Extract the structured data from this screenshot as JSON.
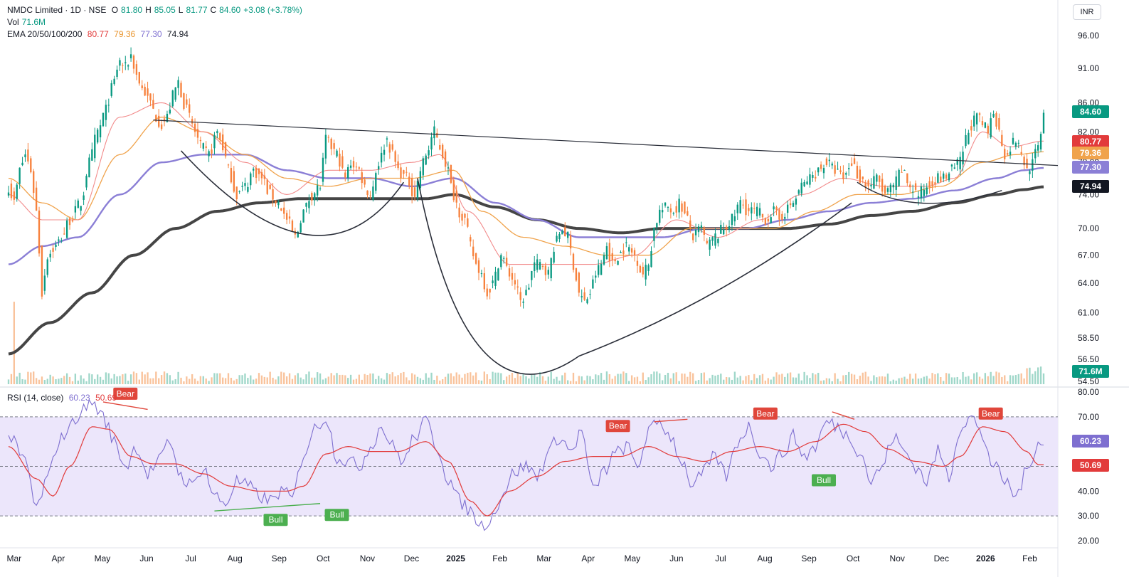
{
  "header": {
    "symbol": "NMDC Limited · 1D · NSE",
    "open_label": "O",
    "open": "81.80",
    "high_label": "H",
    "high": "85.05",
    "low_label": "L",
    "low": "81.77",
    "close_label": "C",
    "close": "84.60",
    "change": "+3.08 (+3.78%)",
    "vol_label": "Vol",
    "vol_value": "71.6M",
    "ema_label": "EMA 20/50/100/200",
    "ema20": "80.77",
    "ema50": "79.36",
    "ema100": "77.30",
    "ema200": "74.94",
    "currency": "INR"
  },
  "rsi_header": {
    "label": "RSI (14, close)",
    "rsi": "60.23",
    "ma": "50.69"
  },
  "colors": {
    "up": "#089981",
    "down": "#f7813c",
    "ema20": "#f28b8b",
    "ema50": "#f0a34c",
    "ema100": "#8b7fd6",
    "ema200": "#454545",
    "rsi": "#7e6fd0",
    "rsi_ma": "#e23b3b",
    "rsi_band": "#ece6fb",
    "bull": "#4caf50",
    "bear": "#e0463b"
  },
  "chart_data": {
    "type": "candlestick",
    "price_axis": {
      "ticks": [
        "96.00",
        "91.00",
        "86.00",
        "82.00",
        "78.00",
        "74.00",
        "70.00",
        "67.00",
        "64.00",
        "61.00",
        "58.50",
        "56.50",
        "54.50"
      ],
      "ylim": [
        54.5,
        96.0
      ],
      "scale": "log"
    },
    "time_axis": {
      "ticks": [
        "Mar",
        "Apr",
        "May",
        "Jun",
        "Jul",
        "Aug",
        "Sep",
        "Oct",
        "Nov",
        "Dec",
        "2025",
        "Feb",
        "Mar",
        "Apr",
        "May",
        "Jun",
        "Jul",
        "Aug",
        "Sep",
        "Oct",
        "Nov",
        "Dec",
        "2026",
        "Feb"
      ],
      "bold_ticks": [
        "2025",
        "2026"
      ]
    },
    "rsi_axis": {
      "ticks": [
        "80.00",
        "70.00",
        "60.00",
        "50.00",
        "40.00",
        "30.00",
        "20.00"
      ],
      "ylim": [
        20,
        80
      ],
      "band": [
        30,
        70
      ]
    },
    "price_anchors": [
      [
        0,
        75
      ],
      [
        2,
        73
      ],
      [
        4,
        77
      ],
      [
        6,
        79
      ],
      [
        8,
        77
      ],
      [
        10,
        72
      ],
      [
        12,
        63
      ],
      [
        14,
        67
      ],
      [
        17,
        68
      ],
      [
        19,
        69
      ],
      [
        22,
        71
      ],
      [
        26,
        73
      ],
      [
        29,
        78
      ],
      [
        32,
        82
      ],
      [
        35,
        85
      ],
      [
        37,
        88
      ],
      [
        40,
        92
      ],
      [
        42,
        91
      ],
      [
        44,
        93
      ],
      [
        46,
        90
      ],
      [
        48,
        88
      ],
      [
        51,
        86
      ],
      [
        53,
        84
      ],
      [
        55,
        83
      ],
      [
        57,
        84
      ],
      [
        59,
        87
      ],
      [
        61,
        89
      ],
      [
        63,
        86
      ],
      [
        65,
        84
      ],
      [
        67,
        82
      ],
      [
        69,
        80
      ],
      [
        72,
        79
      ],
      [
        75,
        82
      ],
      [
        77,
        80
      ],
      [
        79,
        77
      ],
      [
        82,
        74
      ],
      [
        85,
        75
      ],
      [
        88,
        77
      ],
      [
        91,
        76
      ],
      [
        94,
        74
      ],
      [
        97,
        73
      ],
      [
        100,
        71
      ],
      [
        103,
        69
      ],
      [
        106,
        72
      ],
      [
        109,
        74
      ],
      [
        112,
        75
      ],
      [
        114,
        81
      ],
      [
        116,
        80
      ],
      [
        118,
        79
      ],
      [
        121,
        76
      ],
      [
        123,
        78
      ],
      [
        126,
        77
      ],
      [
        128,
        75
      ],
      [
        130,
        74
      ],
      [
        133,
        78
      ],
      [
        136,
        81
      ],
      [
        138,
        79
      ],
      [
        140,
        77
      ],
      [
        143,
        76
      ],
      [
        146,
        74
      ],
      [
        148,
        77
      ],
      [
        150,
        79
      ],
      [
        153,
        82
      ],
      [
        155,
        80
      ],
      [
        157,
        78
      ],
      [
        160,
        74
      ],
      [
        162,
        72
      ],
      [
        164,
        71
      ],
      [
        166,
        68
      ],
      [
        168,
        66
      ],
      [
        170,
        65
      ],
      [
        172,
        63
      ],
      [
        174,
        64
      ],
      [
        177,
        67
      ],
      [
        180,
        65
      ],
      [
        182,
        64
      ],
      [
        184,
        62
      ],
      [
        186,
        63
      ],
      [
        189,
        66
      ],
      [
        192,
        66
      ],
      [
        194,
        65
      ],
      [
        196,
        68
      ],
      [
        199,
        70
      ],
      [
        201,
        69
      ],
      [
        203,
        66
      ],
      [
        205,
        63
      ],
      [
        207,
        62
      ],
      [
        209,
        63
      ],
      [
        211,
        65
      ],
      [
        213,
        66
      ],
      [
        215,
        68
      ],
      [
        217,
        66
      ],
      [
        219,
        67
      ],
      [
        222,
        68
      ],
      [
        225,
        67
      ],
      [
        228,
        65
      ],
      [
        230,
        66
      ],
      [
        232,
        70
      ],
      [
        234,
        72
      ],
      [
        237,
        72.5
      ],
      [
        239,
        72
      ],
      [
        241,
        73
      ],
      [
        244,
        71
      ],
      [
        246,
        69
      ],
      [
        249,
        70
      ],
      [
        251,
        68
      ],
      [
        254,
        69
      ],
      [
        257,
        70
      ],
      [
        260,
        71
      ],
      [
        263,
        73
      ],
      [
        266,
        72
      ],
      [
        269,
        72
      ],
      [
        272,
        71
      ],
      [
        275,
        72
      ],
      [
        277,
        71
      ],
      [
        279,
        72
      ],
      [
        282,
        73
      ],
      [
        285,
        75
      ],
      [
        288,
        76
      ],
      [
        291,
        77
      ],
      [
        294,
        78
      ],
      [
        297,
        77
      ],
      [
        300,
        76
      ],
      [
        303,
        78
      ],
      [
        306,
        76
      ],
      [
        309,
        75
      ],
      [
        312,
        76
      ],
      [
        315,
        74
      ],
      [
        318,
        75
      ],
      [
        321,
        77
      ],
      [
        324,
        75
      ],
      [
        327,
        74
      ],
      [
        330,
        75
      ],
      [
        333,
        76
      ],
      [
        336,
        76
      ],
      [
        339,
        77
      ],
      [
        342,
        78
      ],
      [
        344,
        81
      ],
      [
        346,
        83
      ],
      [
        348,
        84
      ],
      [
        350,
        83
      ],
      [
        352,
        82
      ],
      [
        354,
        85
      ],
      [
        356,
        82
      ],
      [
        358,
        79
      ],
      [
        360,
        80
      ],
      [
        362,
        81
      ],
      [
        364,
        79
      ],
      [
        366,
        77
      ],
      [
        368,
        78
      ],
      [
        370,
        80
      ],
      [
        372,
        84.6
      ]
    ],
    "ema20_anchors": [
      [
        0,
        74
      ],
      [
        12,
        71
      ],
      [
        25,
        71
      ],
      [
        40,
        84
      ],
      [
        55,
        86
      ],
      [
        70,
        82
      ],
      [
        85,
        78
      ],
      [
        100,
        74
      ],
      [
        115,
        77
      ],
      [
        130,
        77
      ],
      [
        145,
        78
      ],
      [
        155,
        79
      ],
      [
        165,
        72
      ],
      [
        180,
        66
      ],
      [
        195,
        66
      ],
      [
        210,
        66
      ],
      [
        225,
        67
      ],
      [
        240,
        71
      ],
      [
        255,
        69
      ],
      [
        270,
        71
      ],
      [
        285,
        74
      ],
      [
        300,
        76
      ],
      [
        315,
        75
      ],
      [
        330,
        75
      ],
      [
        340,
        76
      ],
      [
        350,
        82
      ],
      [
        360,
        80
      ],
      [
        372,
        80.77
      ]
    ],
    "ema50_anchors": [
      [
        0,
        76
      ],
      [
        12,
        73
      ],
      [
        25,
        71
      ],
      [
        40,
        79
      ],
      [
        55,
        84
      ],
      [
        70,
        82
      ],
      [
        85,
        79
      ],
      [
        100,
        76
      ],
      [
        115,
        75
      ],
      [
        130,
        76
      ],
      [
        145,
        76
      ],
      [
        160,
        77
      ],
      [
        170,
        72
      ],
      [
        185,
        69
      ],
      [
        200,
        68
      ],
      [
        215,
        67
      ],
      [
        230,
        67
      ],
      [
        245,
        70
      ],
      [
        260,
        70
      ],
      [
        275,
        70
      ],
      [
        290,
        72
      ],
      [
        305,
        74
      ],
      [
        320,
        74
      ],
      [
        335,
        75
      ],
      [
        350,
        78
      ],
      [
        362,
        79
      ],
      [
        372,
        79.36
      ]
    ],
    "ema100_anchors": [
      [
        0,
        66
      ],
      [
        12,
        68
      ],
      [
        25,
        69
      ],
      [
        40,
        74
      ],
      [
        55,
        78
      ],
      [
        70,
        79
      ],
      [
        85,
        79
      ],
      [
        100,
        77
      ],
      [
        115,
        76
      ],
      [
        130,
        76
      ],
      [
        145,
        75
      ],
      [
        160,
        76
      ],
      [
        175,
        73
      ],
      [
        190,
        71
      ],
      [
        205,
        69
      ],
      [
        220,
        69
      ],
      [
        235,
        69
      ],
      [
        250,
        70
      ],
      [
        265,
        70
      ],
      [
        280,
        71
      ],
      [
        295,
        72
      ],
      [
        310,
        73
      ],
      [
        325,
        73.5
      ],
      [
        340,
        74.5
      ],
      [
        355,
        76
      ],
      [
        365,
        77
      ],
      [
        372,
        77.3
      ]
    ],
    "ema200_anchors": [
      [
        0,
        57
      ],
      [
        15,
        60
      ],
      [
        30,
        63
      ],
      [
        45,
        67
      ],
      [
        60,
        70
      ],
      [
        75,
        72
      ],
      [
        90,
        73
      ],
      [
        105,
        73.5
      ],
      [
        120,
        73.5
      ],
      [
        135,
        73.5
      ],
      [
        150,
        73.5
      ],
      [
        160,
        74
      ],
      [
        175,
        72.5
      ],
      [
        190,
        71
      ],
      [
        205,
        70
      ],
      [
        220,
        69.5
      ],
      [
        235,
        70
      ],
      [
        250,
        70
      ],
      [
        265,
        70
      ],
      [
        280,
        70
      ],
      [
        295,
        70.5
      ],
      [
        310,
        71.5
      ],
      [
        325,
        72
      ],
      [
        340,
        73
      ],
      [
        355,
        74
      ],
      [
        365,
        74.6
      ],
      [
        372,
        74.94
      ]
    ],
    "rsi_anchors": [
      [
        0,
        62
      ],
      [
        6,
        52
      ],
      [
        10,
        33
      ],
      [
        14,
        45
      ],
      [
        18,
        60
      ],
      [
        22,
        66
      ],
      [
        26,
        72
      ],
      [
        30,
        76
      ],
      [
        34,
        70
      ],
      [
        38,
        60
      ],
      [
        42,
        50
      ],
      [
        46,
        58
      ],
      [
        50,
        47
      ],
      [
        54,
        52
      ],
      [
        58,
        60
      ],
      [
        62,
        46
      ],
      [
        66,
        42
      ],
      [
        70,
        50
      ],
      [
        74,
        38
      ],
      [
        78,
        35
      ],
      [
        82,
        44
      ],
      [
        86,
        42
      ],
      [
        90,
        38
      ],
      [
        94,
        36
      ],
      [
        98,
        40
      ],
      [
        102,
        37
      ],
      [
        106,
        55
      ],
      [
        110,
        65
      ],
      [
        114,
        70
      ],
      [
        118,
        54
      ],
      [
        122,
        52
      ],
      [
        126,
        50
      ],
      [
        130,
        58
      ],
      [
        134,
        66
      ],
      [
        138,
        58
      ],
      [
        142,
        52
      ],
      [
        146,
        62
      ],
      [
        150,
        68
      ],
      [
        154,
        58
      ],
      [
        158,
        45
      ],
      [
        162,
        36
      ],
      [
        166,
        32
      ],
      [
        170,
        26
      ],
      [
        174,
        30
      ],
      [
        178,
        40
      ],
      [
        182,
        48
      ],
      [
        186,
        50
      ],
      [
        190,
        46
      ],
      [
        194,
        56
      ],
      [
        198,
        62
      ],
      [
        202,
        56
      ],
      [
        206,
        64
      ],
      [
        210,
        40
      ],
      [
        214,
        48
      ],
      [
        218,
        55
      ],
      [
        222,
        58
      ],
      [
        226,
        50
      ],
      [
        230,
        64
      ],
      [
        234,
        68
      ],
      [
        238,
        62
      ],
      [
        242,
        52
      ],
      [
        246,
        42
      ],
      [
        250,
        48
      ],
      [
        254,
        54
      ],
      [
        258,
        46
      ],
      [
        262,
        60
      ],
      [
        266,
        66
      ],
      [
        270,
        56
      ],
      [
        274,
        50
      ],
      [
        278,
        55
      ],
      [
        282,
        62
      ],
      [
        286,
        54
      ],
      [
        290,
        58
      ],
      [
        294,
        68
      ],
      [
        298,
        66
      ],
      [
        302,
        62
      ],
      [
        306,
        56
      ],
      [
        310,
        44
      ],
      [
        314,
        50
      ],
      [
        318,
        62
      ],
      [
        322,
        56
      ],
      [
        326,
        50
      ],
      [
        330,
        44
      ],
      [
        334,
        56
      ],
      [
        338,
        46
      ],
      [
        342,
        66
      ],
      [
        346,
        70
      ],
      [
        350,
        62
      ],
      [
        354,
        50
      ],
      [
        358,
        44
      ],
      [
        362,
        38
      ],
      [
        366,
        48
      ],
      [
        370,
        60.23
      ]
    ],
    "rsi_ma_anchors": [
      [
        0,
        58
      ],
      [
        10,
        45
      ],
      [
        16,
        38
      ],
      [
        22,
        50
      ],
      [
        30,
        66
      ],
      [
        36,
        65
      ],
      [
        44,
        54
      ],
      [
        52,
        51
      ],
      [
        60,
        51
      ],
      [
        70,
        47
      ],
      [
        80,
        42
      ],
      [
        90,
        40
      ],
      [
        100,
        40
      ],
      [
        106,
        42
      ],
      [
        114,
        55
      ],
      [
        122,
        58
      ],
      [
        130,
        56
      ],
      [
        140,
        56
      ],
      [
        150,
        60
      ],
      [
        158,
        52
      ],
      [
        166,
        36
      ],
      [
        172,
        30
      ],
      [
        180,
        40
      ],
      [
        190,
        46
      ],
      [
        200,
        52
      ],
      [
        210,
        54
      ],
      [
        220,
        54
      ],
      [
        230,
        58
      ],
      [
        240,
        54
      ],
      [
        250,
        52
      ],
      [
        260,
        56
      ],
      [
        270,
        58
      ],
      [
        280,
        56
      ],
      [
        290,
        60
      ],
      [
        300,
        67
      ],
      [
        308,
        64
      ],
      [
        316,
        57
      ],
      [
        326,
        52
      ],
      [
        336,
        50
      ],
      [
        342,
        54
      ],
      [
        350,
        66
      ],
      [
        358,
        64
      ],
      [
        366,
        56
      ],
      [
        370,
        50.69
      ]
    ],
    "volume_last": "71.6M",
    "pattern_lines": {
      "neckline": "resistance trend line",
      "cup": "cup and handle curves"
    },
    "annotations": [
      {
        "text": "Bear",
        "type": "bear",
        "i": 42,
        "rsi": 76
      },
      {
        "text": "Bull",
        "type": "bull",
        "i": 96,
        "rsi": 32
      },
      {
        "text": "Bull",
        "type": "bull",
        "i": 118,
        "rsi": 34
      },
      {
        "text": "Bear",
        "type": "bear",
        "i": 219,
        "rsi": 63
      },
      {
        "text": "Bear",
        "type": "bear",
        "i": 272,
        "rsi": 68
      },
      {
        "text": "Bull",
        "type": "bull",
        "i": 293,
        "rsi": 48
      },
      {
        "text": "Bear",
        "type": "bear",
        "i": 353,
        "rsi": 68
      }
    ],
    "last_labels": [
      {
        "value": "84.60",
        "color": "#089981"
      },
      {
        "value": "80.77",
        "color": "#e23b3b"
      },
      {
        "value": "79.36",
        "color": "#f0a34c"
      },
      {
        "value": "77.30",
        "color": "#8b7fd6"
      },
      {
        "value": "74.94",
        "color": "#131722"
      }
    ],
    "rsi_last_labels": [
      {
        "value": "60.23",
        "color": "#7e6fd0"
      },
      {
        "value": "50.69",
        "color": "#e23b3b"
      }
    ]
  }
}
